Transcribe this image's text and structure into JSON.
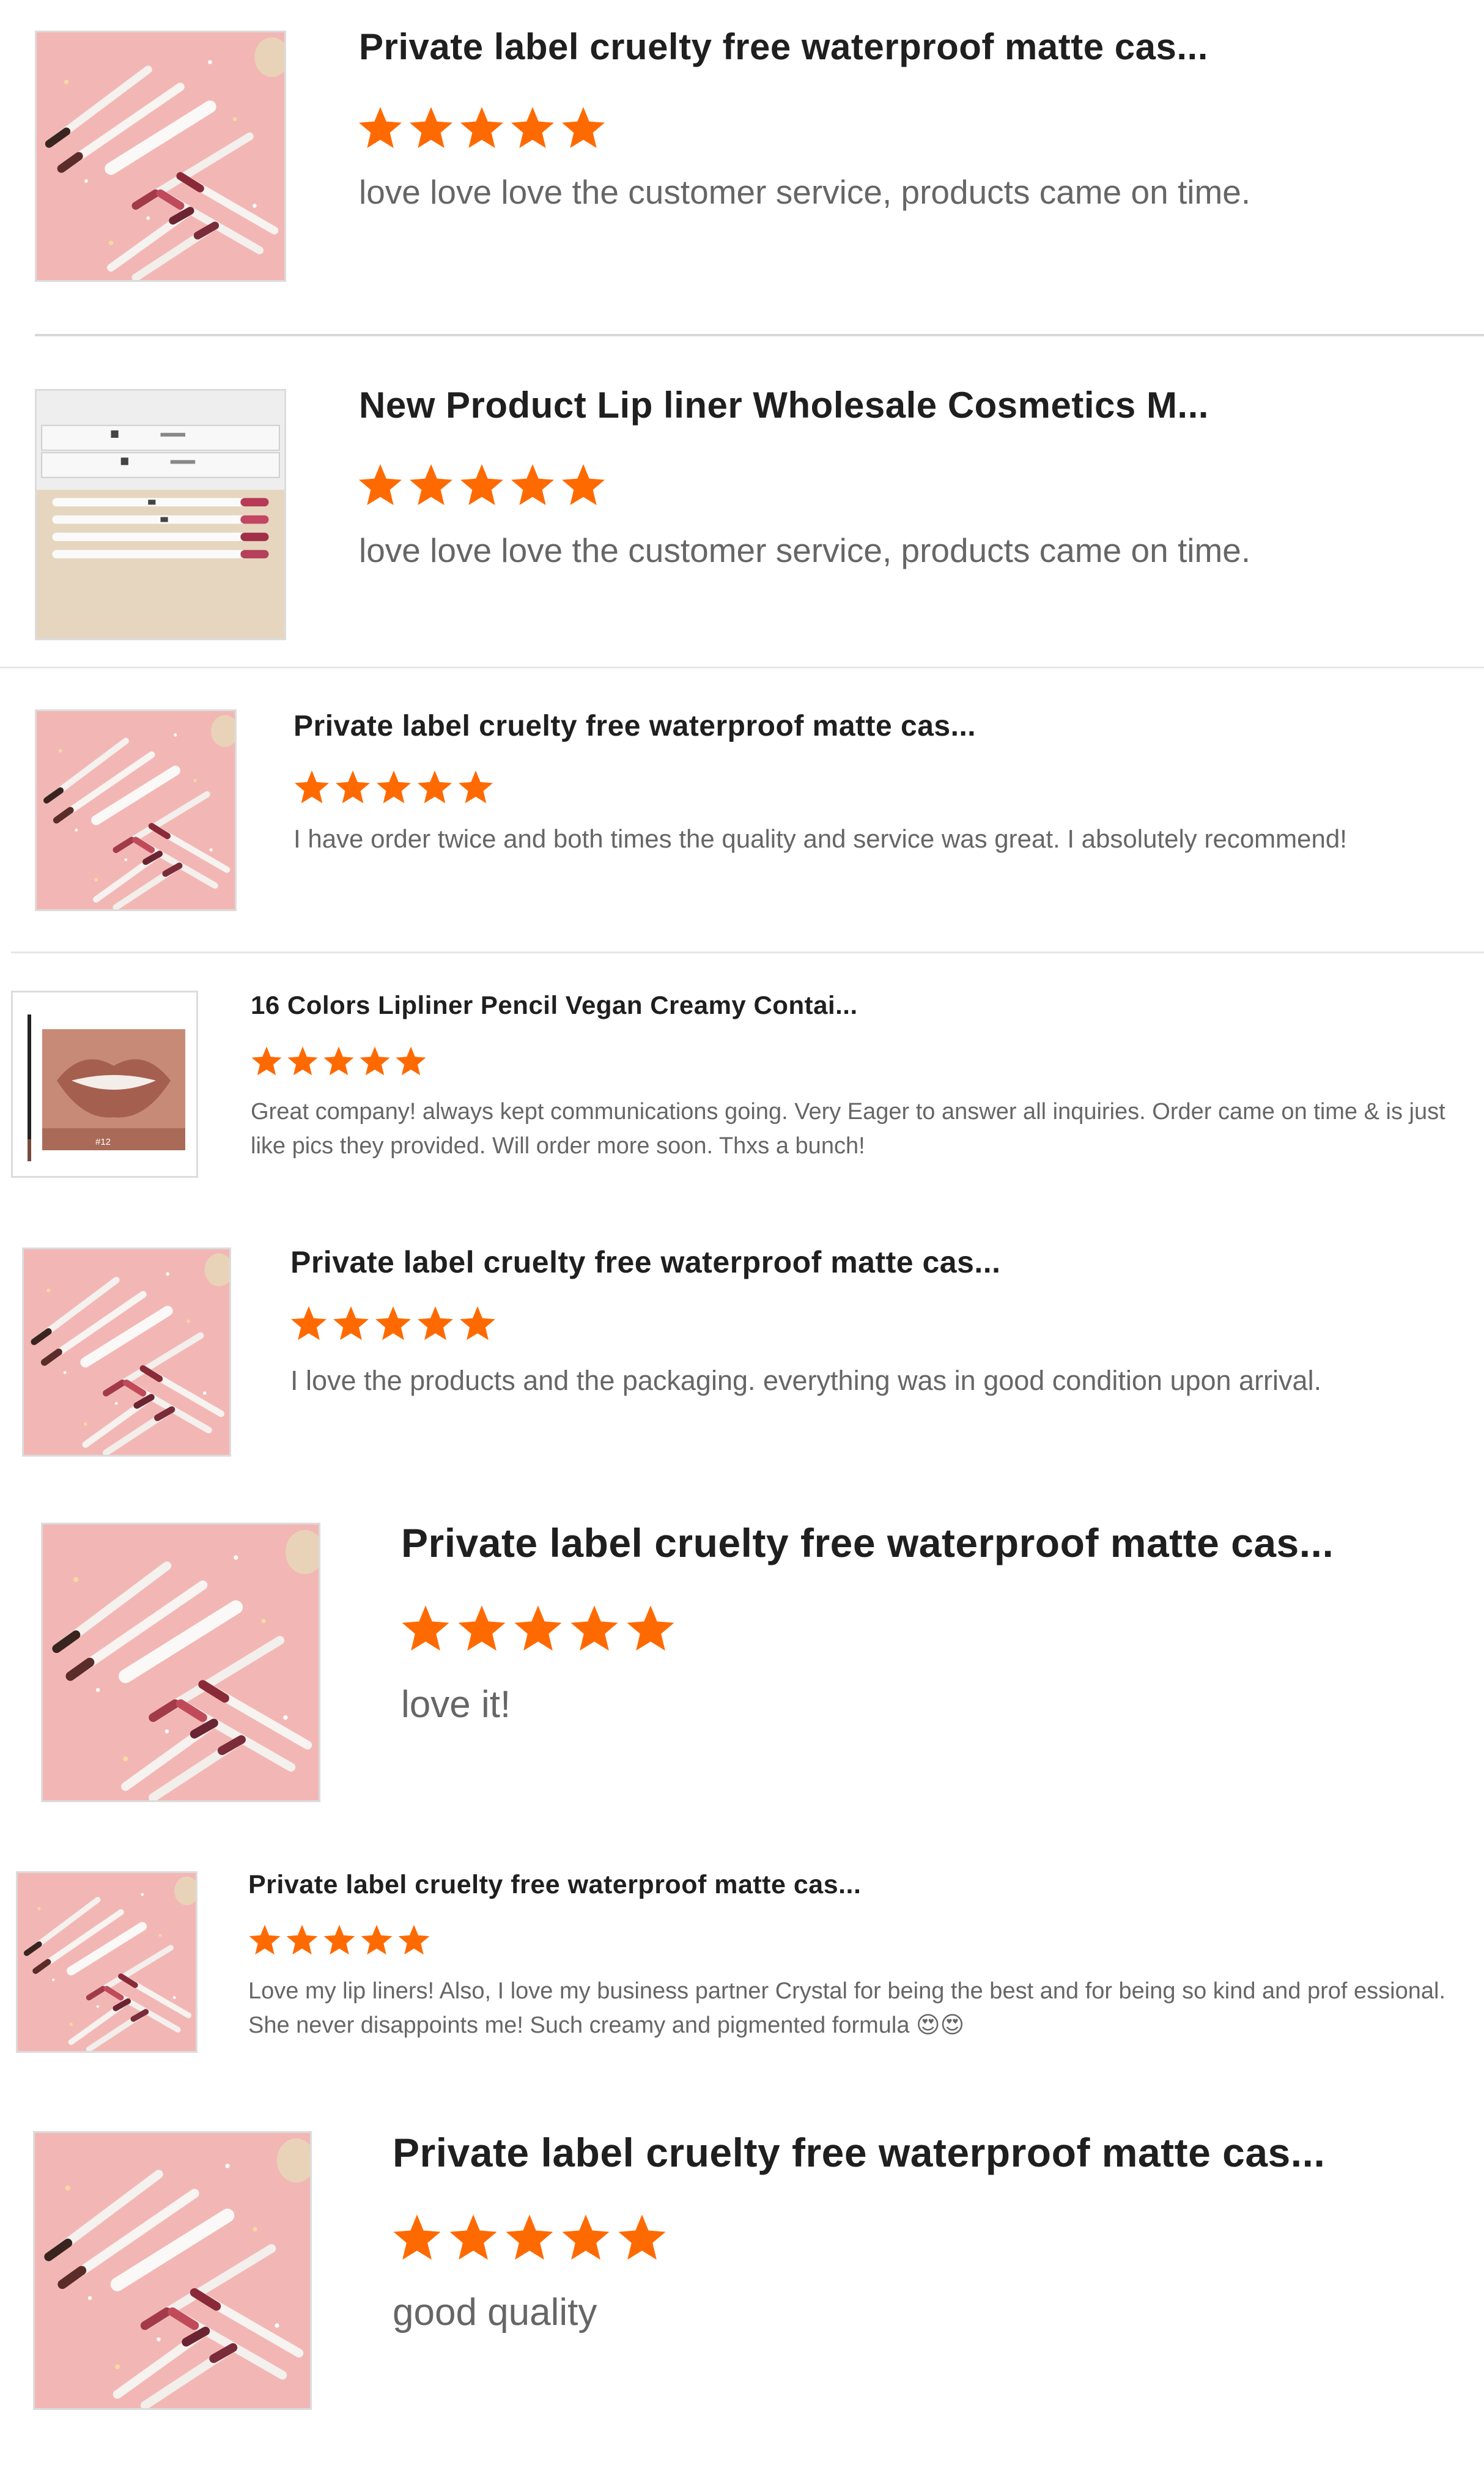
{
  "colors": {
    "star": "#ff6a00",
    "title": "#1f1f1f",
    "body_text": "#666666",
    "divider": "#d8d8d8"
  },
  "reviews": [
    {
      "title": "Private label cruelty free waterproof matte cas...",
      "rating": 5,
      "text": "love love love the customer service, products came on time.",
      "image": "lip-liner-pencils-on-pink"
    },
    {
      "title": "New Product Lip liner Wholesale Cosmetics M...",
      "rating": 5,
      "text": "love love love the customer service, products came on time.",
      "image": "lip-liner-boxes-on-table"
    },
    {
      "title": "Private label cruelty free waterproof matte cas...",
      "rating": 5,
      "text": "I have order twice and both times the quality and service was great. I absolutely recommend!",
      "image": "lip-liner-pencils-on-pink"
    },
    {
      "title": "16 Colors Lipliner Pencil Vegan Creamy Contai...",
      "rating": 5,
      "text": "Great company! always kept communications going. Very Eager to answer all inquiries. Order came on time & is just like pics they provided. Will order more soon. Thxs a bunch!",
      "image": "lips-swatch-with-pencil",
      "swatch_label": "#12"
    },
    {
      "title": "Private label cruelty free waterproof matte cas...",
      "rating": 5,
      "text": "I love the products and the packaging. everything was in good condition upon arrival.",
      "image": "lip-liner-pencils-on-pink"
    },
    {
      "title": "Private label cruelty free waterproof matte cas...",
      "rating": 5,
      "text": "love it!",
      "image": "lip-liner-pencils-on-pink"
    },
    {
      "title": "Private label cruelty free waterproof matte cas...",
      "rating": 5,
      "text": "Love my lip liners! Also, I love my business partner Crystal for being the best and for being so kind and prof essional. She never disappoints me! Such creamy and pigmented formula 😍😍",
      "image": "lip-liner-pencils-on-pink"
    },
    {
      "title": "Private label cruelty free waterproof matte cas...",
      "rating": 5,
      "text": "good quality",
      "image": "lip-liner-pencils-on-pink"
    }
  ]
}
